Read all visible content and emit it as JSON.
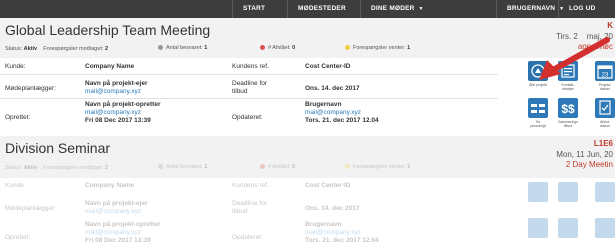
{
  "nav": {
    "start": "START",
    "venues": "MØDESTEDER",
    "my_meetings": "DINE MØDER",
    "username": "BRUGERNAVN",
    "logout": "LOG UD"
  },
  "meetings": [
    {
      "title": "Global Leadership Team Meeting",
      "status_label": "Status:",
      "status_value": "Aktiv",
      "requests_label": "Forespørgsler modtaget:",
      "requests_value": "2",
      "answered_label": "Antal besvaret:",
      "answered_value": "1",
      "declined_label": "# Afslået:",
      "declined_value": "0",
      "pending_label": "Forespørgsler venter:",
      "pending_value": "1",
      "code": "K",
      "date": "Tirs. 2",
      "date_rest": "maj, 20",
      "countdown": "ages møc",
      "customer_label": "Kunde:",
      "customer_value": "Company Name",
      "customer_ref_label": "Kundens ref.",
      "customer_ref_value": "Cost Center-ID",
      "planner_label": "Mødeplanlægger:",
      "planner_name": "Navn på projekt-ejer",
      "planner_mail": "mail@company.xyz",
      "deadline_label_1": "Deadline for",
      "deadline_label_2": "tilbud",
      "deadline_value": "Ons. 14. dec 2017",
      "created_label": "Oprettet:",
      "creator_name": "Navn på projekt-opretter",
      "creator_mail": "mail@company.xyz",
      "created_date": "Fri 08 Dec 2017   13:39",
      "updated_label": "Opdateret:",
      "updater_name": "Brugernavn",
      "updater_mail": "mail@company.xyz",
      "updated_date": "Tors. 21. dec 2017   12.04",
      "tiles": [
        "Åbn projekt",
        "Kontakt-\ndetaljer",
        "Projekt-\ndatoer",
        "Se\nprosverigt",
        "Sammenlign\ntilbud",
        "Afslut-\ndokum"
      ]
    },
    {
      "title": "Division Seminar",
      "status_label": "Status:",
      "status_value": "Aktiv",
      "requests_label": "Forespørgsler modtaget:",
      "requests_value": "2",
      "answered_label": "Antal besvaret:",
      "answered_value": "1",
      "declined_label": "# Afslået:",
      "declined_value": "0",
      "pending_label": "Forespørgsler venter:",
      "pending_value": "1",
      "code": "L1E6",
      "date": "Mon, 11 Jun, 20",
      "countdown": "2 Day Meetin",
      "customer_label": "Kunde:",
      "customer_value": "Company Name",
      "customer_ref_label": "Kundens ref.",
      "customer_ref_value": "Cost Center-ID",
      "planner_label": "Mødeplanlægger:",
      "planner_name": "Navn på projekt-ejer",
      "planner_mail": "mail@company.xyz",
      "deadline_label_1": "Deadline for",
      "deadline_label_2": "tilbud",
      "deadline_value": "Ons. 14. dec 2017",
      "created_label": "Oprettet:",
      "creator_name": "Navn på projekt-opretter",
      "creator_mail": "mail@company.xyz",
      "created_date": "Fri 08 Dec 2017   13:39",
      "updated_label": "Opdateret:",
      "updater_name": "Brugernavn",
      "updater_mail": "mail@company.xyz",
      "updated_date": "Tors. 21. dec 2017   12.04"
    }
  ],
  "colors": {
    "nav_bg": "#3d3d3d",
    "accent_red": "#c0392b",
    "tile_blue": "#2e7ab8",
    "dot_gray": "#9a9a9a",
    "dot_red": "#e05050",
    "dot_yellow": "#f0d040"
  }
}
